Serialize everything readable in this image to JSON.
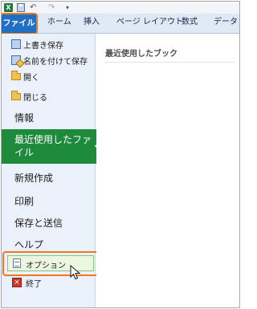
{
  "toolbar": {
    "app_icon": "excel-icon",
    "app_icon_letter": "X",
    "icons": [
      "save-icon",
      "undo-icon",
      "redo-icon",
      "customize-qat-icon"
    ]
  },
  "ribbon": {
    "tabs": [
      "ファイル",
      "ホーム",
      "挿入",
      "ページ レイアウト",
      "数式",
      "データ"
    ],
    "file_tab_color": "#1f6fc5",
    "highlight_color": "#ec7a1c"
  },
  "backstage": {
    "commands": [
      {
        "label": "上書き保存",
        "icon": "save-icon"
      },
      {
        "label": "名前を付けて保存",
        "icon": "save-as-icon"
      },
      {
        "label": "開く",
        "icon": "open-folder-icon"
      },
      {
        "label": "閉じる",
        "icon": "close-folder-icon"
      }
    ],
    "tabs": [
      "情報",
      "最近使用したファイル",
      "新規作成",
      "印刷",
      "保存と送信",
      "ヘルプ"
    ],
    "selected_tab": "最近使用したファイル",
    "selected_color": "#1e8a3c",
    "options_label": "オプション",
    "options_icon": "options-icon",
    "exit_label": "終了",
    "exit_icon": "exit-icon"
  },
  "main": {
    "heading": "最近使用したブック"
  }
}
